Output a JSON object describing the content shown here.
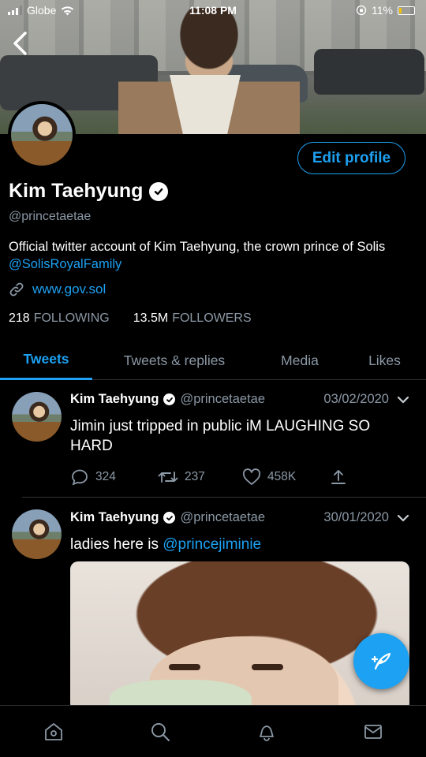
{
  "status_bar": {
    "carrier": "Globe",
    "time": "11:08 PM",
    "battery": "11%"
  },
  "profile": {
    "name": "Kim Taehyung",
    "handle": "@princetaetae",
    "edit_label": "Edit profile",
    "bio_text": "Official twitter account of Kim Taehyung, the crown prince of Solis ",
    "bio_mention": "@SolisRoyalFamily",
    "website": "www.gov.sol",
    "following_count": "218",
    "following_label": "FOLLOWING",
    "followers_count": "13.5M",
    "followers_label": "FOLLOWERS"
  },
  "tabs": [
    {
      "label": "Tweets"
    },
    {
      "label": "Tweets & replies"
    },
    {
      "label": "Media"
    },
    {
      "label": "Likes"
    }
  ],
  "tweets": [
    {
      "name": "Kim Taehyung",
      "handle": "@princetaetae",
      "date": "03/02/2020",
      "text": "Jimin just tripped in public iM LAUGHING SO HARD",
      "replies": "324",
      "retweets": "237",
      "likes": "458K"
    },
    {
      "name": "Kim Taehyung",
      "handle": "@princetaetae",
      "date": "30/01/2020",
      "text_prefix": "ladies here is ",
      "text_mention": "@princejiminie"
    }
  ],
  "colors": {
    "accent": "#1da1f2",
    "muted": "#8b98a5",
    "background": "#000000"
  },
  "icons": [
    "back-arrow-icon",
    "verified-icon",
    "link-icon",
    "reply-icon",
    "retweet-icon",
    "like-icon",
    "share-icon",
    "chevron-down-icon",
    "compose-icon",
    "home-icon",
    "search-icon",
    "notifications-icon",
    "messages-icon"
  ]
}
